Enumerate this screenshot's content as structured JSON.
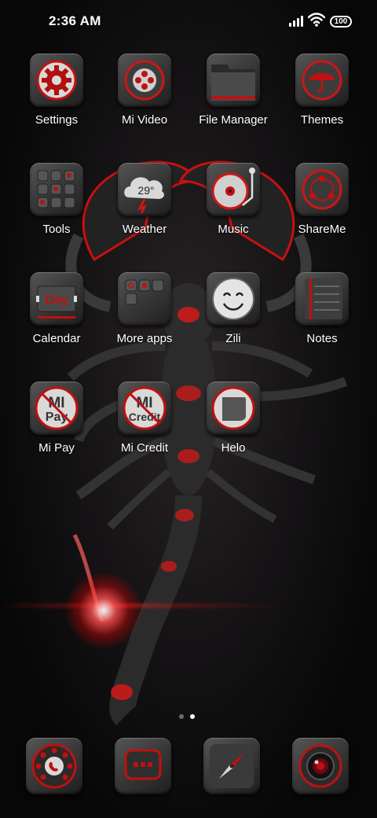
{
  "status": {
    "time": "2:36 AM",
    "battery": "100"
  },
  "apps": [
    {
      "label": "Settings",
      "icon": "settings-gear-icon"
    },
    {
      "label": "Mi Video",
      "icon": "mi-video-icon"
    },
    {
      "label": "File Manager",
      "icon": "folder-icon"
    },
    {
      "label": "Themes",
      "icon": "umbrella-icon"
    },
    {
      "label": "Tools",
      "icon": "tools-grid-icon"
    },
    {
      "label": "Weather",
      "icon": "weather-cloud-icon",
      "badge": "29°"
    },
    {
      "label": "Music",
      "icon": "turntable-icon"
    },
    {
      "label": "ShareMe",
      "icon": "share-icon"
    },
    {
      "label": "Calendar",
      "icon": "calendar-icon",
      "badge": "Day"
    },
    {
      "label": "More apps",
      "icon": "more-apps-folder-icon"
    },
    {
      "label": "Zili",
      "icon": "smiley-face-icon"
    },
    {
      "label": "Notes",
      "icon": "notes-icon"
    },
    {
      "label": "Mi Pay",
      "icon": "mi-pay-icon",
      "badge": [
        "MI",
        "Pay"
      ]
    },
    {
      "label": "Mi Credit",
      "icon": "mi-credit-icon",
      "badge": [
        "MI",
        "Credit"
      ]
    },
    {
      "label": "Helo",
      "icon": "helo-icon"
    }
  ],
  "dock": [
    {
      "icon": "rotary-phone-icon"
    },
    {
      "icon": "messages-icon"
    },
    {
      "icon": "compass-browser-icon"
    },
    {
      "icon": "camera-lens-icon"
    }
  ],
  "page_indicator": {
    "pages": 2,
    "active": 2
  },
  "colors": {
    "accent": "#e0121b",
    "tile": "#3c3c3c"
  }
}
